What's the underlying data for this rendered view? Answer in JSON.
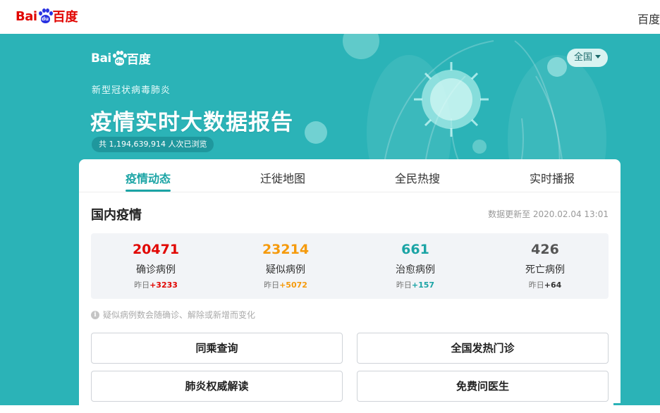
{
  "topbar": {
    "logo": {
      "bai": "Bai",
      "du": "du",
      "cn": "百度"
    },
    "right_text": "百度"
  },
  "banner": {
    "logo": {
      "bai": "Bai",
      "du": "du",
      "cn": "百度"
    },
    "subtitle": "新型冠状病毒肺炎",
    "headline": "疫情实时大数据报告",
    "views": "共 1,194,639,914 人次已浏览",
    "region_selector": "全国",
    "colors": {
      "banner_bg": "#2bb3b7",
      "accent": "#1ba4a5"
    }
  },
  "tabs": [
    {
      "label": "疫情动态",
      "active": true
    },
    {
      "label": "迁徙地图",
      "active": false
    },
    {
      "label": "全民热搜",
      "active": false
    },
    {
      "label": "实时播报",
      "active": false
    }
  ],
  "domestic": {
    "title": "国内疫情",
    "updated": "数据更新至 2020.02.04 13:01",
    "stats": [
      {
        "value": "20471",
        "label": "确诊病例",
        "yday_prefix": "昨日",
        "yday_delta": "+3233",
        "color": "#e10602"
      },
      {
        "value": "23214",
        "label": "疑似病例",
        "yday_prefix": "昨日",
        "yday_delta": "+5072",
        "color": "#f59a0c"
      },
      {
        "value": "661",
        "label": "治愈病例",
        "yday_prefix": "昨日",
        "yday_delta": "+157",
        "color": "#1ba4a5"
      },
      {
        "value": "426",
        "label": "死亡病例",
        "yday_prefix": "昨日",
        "yday_delta": "+64",
        "color": "#555555"
      }
    ],
    "note": "疑似病例数会随确诊、解除或新增而变化",
    "note_icon": "info-icon"
  },
  "buttons": [
    {
      "label": "同乘查询"
    },
    {
      "label": "全国发热门诊"
    },
    {
      "label": "肺炎权威解读"
    },
    {
      "label": "免费问医生"
    }
  ]
}
